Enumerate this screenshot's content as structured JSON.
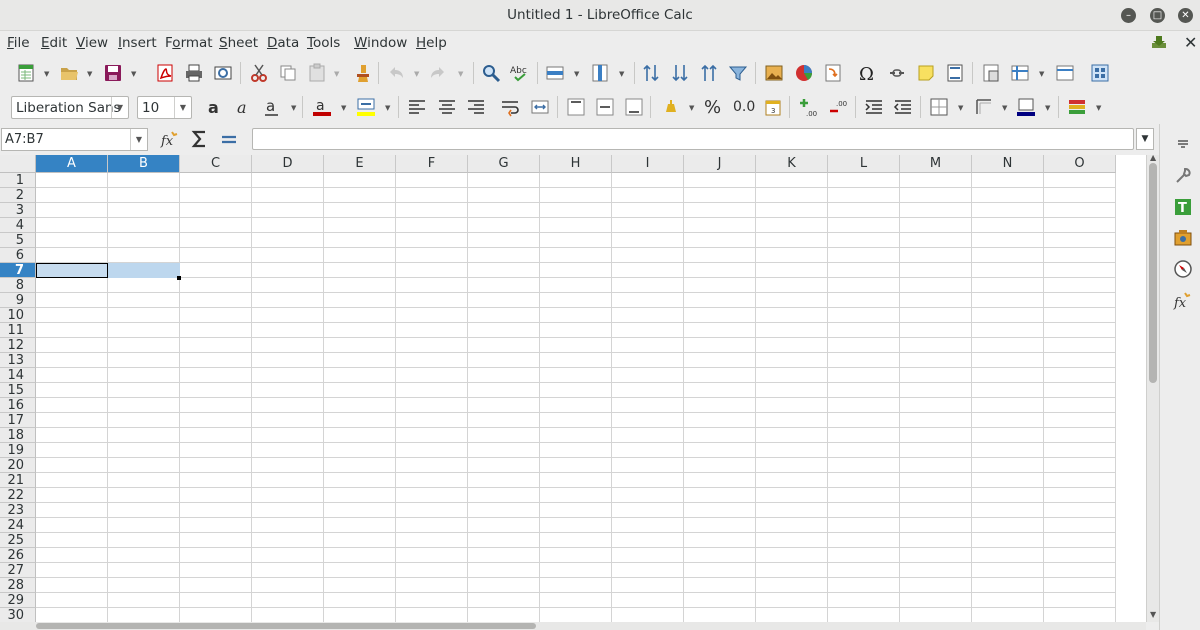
{
  "window": {
    "title": "Untitled 1 - LibreOffice Calc"
  },
  "menu": [
    {
      "pre": "",
      "u": "F",
      "post": "ile"
    },
    {
      "pre": "",
      "u": "E",
      "post": "dit"
    },
    {
      "pre": "",
      "u": "V",
      "post": "iew"
    },
    {
      "pre": "",
      "u": "I",
      "post": "nsert"
    },
    {
      "pre": "F",
      "u": "o",
      "post": "rmat"
    },
    {
      "pre": "",
      "u": "S",
      "post": "heet"
    },
    {
      "pre": "",
      "u": "D",
      "post": "ata"
    },
    {
      "pre": "",
      "u": "T",
      "post": "ools"
    },
    {
      "pre": "",
      "u": "W",
      "post": "indow"
    },
    {
      "pre": "",
      "u": "H",
      "post": "elp"
    }
  ],
  "format_toolbar": {
    "font_name": "Liberation Sans",
    "font_size": "10",
    "percent_label": "%",
    "decimal_label": "0.0"
  },
  "formula_bar": {
    "name_box": "A7:B7",
    "formula": ""
  },
  "grid": {
    "columns": [
      "A",
      "B",
      "C",
      "D",
      "E",
      "F",
      "G",
      "H",
      "I",
      "J",
      "K",
      "L",
      "M",
      "N",
      "O"
    ],
    "rows": [
      "1",
      "2",
      "3",
      "4",
      "5",
      "6",
      "7",
      "8",
      "9",
      "10",
      "11",
      "12",
      "13",
      "14",
      "15",
      "16",
      "17",
      "18",
      "19",
      "20",
      "21",
      "22",
      "23",
      "24",
      "25",
      "26",
      "27",
      "28",
      "29",
      "30"
    ],
    "selected_columns": [
      "A",
      "B"
    ],
    "selected_row": "7",
    "active_cell": "A7",
    "selection": "A7:B7"
  },
  "colors": {
    "accent": "#3583c4",
    "selection_fill": "#bdd7ee",
    "font_color": "#c00000",
    "highlight_color": "#ffff00",
    "border_color": "#000080"
  }
}
